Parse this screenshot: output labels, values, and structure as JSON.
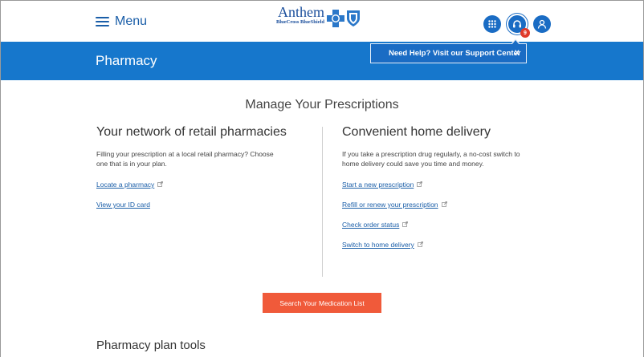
{
  "header": {
    "menu_label": "Menu",
    "logo_name": "Anthem",
    "logo_sub": "BlueCross BlueShield",
    "notification_count": "9"
  },
  "banner": {
    "title": "Pharmacy",
    "callout_text": "Need Help? Visit our Support Center",
    "callout_close": "X"
  },
  "main": {
    "title": "Manage Your Prescriptions",
    "retail": {
      "title": "Your network of retail pharmacies",
      "text_line1": "Filling your prescription at a local retail pharmacy? Choose",
      "text_line2": "one that is in your plan.",
      "links": [
        "Locate a pharmacy",
        "View your ID card"
      ]
    },
    "home": {
      "title": "Convenient home delivery",
      "text_line1": "If you take a prescription drug regularly, a no-cost switch to",
      "text_line2": "home delivery could save you time and money.",
      "links": [
        "Start a new prescription",
        "Refill or renew your prescription",
        "Check order status",
        "Switch to home delivery"
      ]
    },
    "search_button": "Search Your Medication List",
    "tools_title": "Pharmacy plan tools"
  },
  "colors": {
    "brand_blue": "#1677cc",
    "link_blue": "#1a5ea8",
    "cta_orange": "#f05a3a",
    "badge_red": "#e03a2a"
  }
}
